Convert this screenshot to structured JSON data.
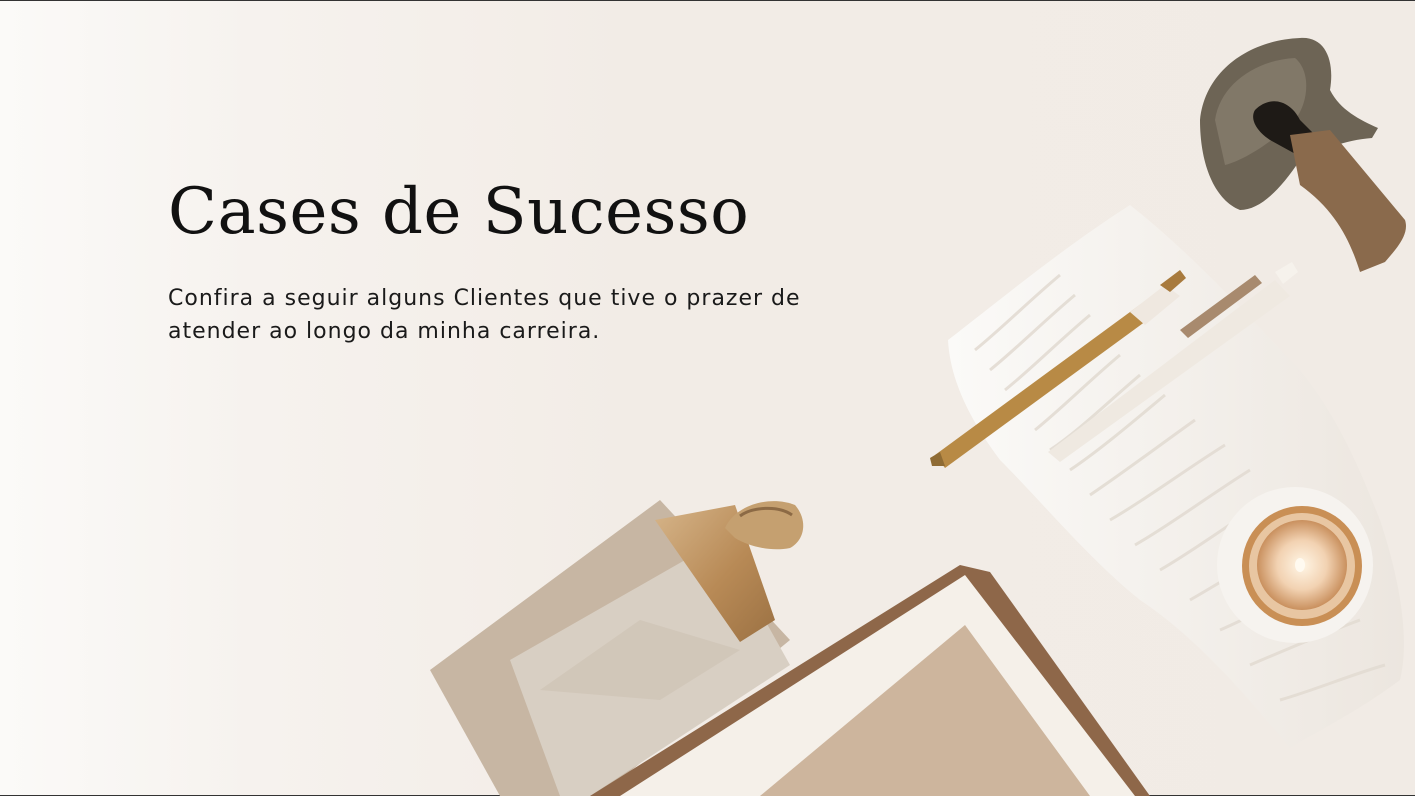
{
  "slide": {
    "title": "Cases de Sucesso",
    "subtitle_line1": "Confira a seguir alguns Clientes que tive o prazer de",
    "subtitle_line2": "atender ao longo da minha carreira."
  },
  "colors": {
    "background": "#f1ebe5",
    "text": "#111111",
    "accent_gold": "#b98b4f",
    "kraft": "#cdbba8"
  }
}
